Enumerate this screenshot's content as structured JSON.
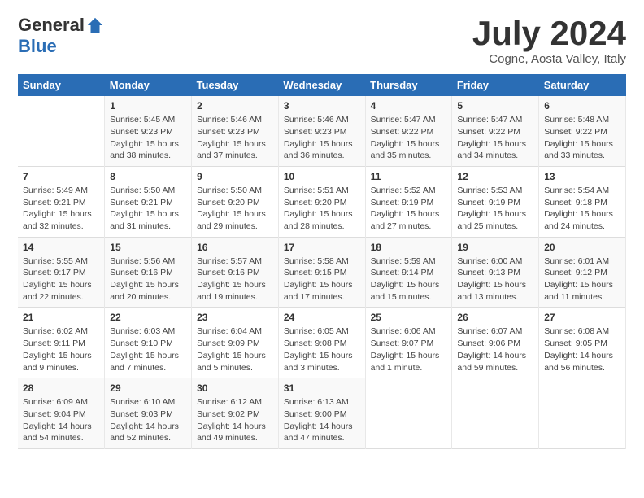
{
  "header": {
    "logo_general": "General",
    "logo_blue": "Blue",
    "month_year": "July 2024",
    "location": "Cogne, Aosta Valley, Italy"
  },
  "days_of_week": [
    "Sunday",
    "Monday",
    "Tuesday",
    "Wednesday",
    "Thursday",
    "Friday",
    "Saturday"
  ],
  "weeks": [
    [
      {
        "day": "",
        "content": ""
      },
      {
        "day": "1",
        "content": "Sunrise: 5:45 AM\nSunset: 9:23 PM\nDaylight: 15 hours\nand 38 minutes."
      },
      {
        "day": "2",
        "content": "Sunrise: 5:46 AM\nSunset: 9:23 PM\nDaylight: 15 hours\nand 37 minutes."
      },
      {
        "day": "3",
        "content": "Sunrise: 5:46 AM\nSunset: 9:23 PM\nDaylight: 15 hours\nand 36 minutes."
      },
      {
        "day": "4",
        "content": "Sunrise: 5:47 AM\nSunset: 9:22 PM\nDaylight: 15 hours\nand 35 minutes."
      },
      {
        "day": "5",
        "content": "Sunrise: 5:47 AM\nSunset: 9:22 PM\nDaylight: 15 hours\nand 34 minutes."
      },
      {
        "day": "6",
        "content": "Sunrise: 5:48 AM\nSunset: 9:22 PM\nDaylight: 15 hours\nand 33 minutes."
      }
    ],
    [
      {
        "day": "7",
        "content": "Sunrise: 5:49 AM\nSunset: 9:21 PM\nDaylight: 15 hours\nand 32 minutes."
      },
      {
        "day": "8",
        "content": "Sunrise: 5:50 AM\nSunset: 9:21 PM\nDaylight: 15 hours\nand 31 minutes."
      },
      {
        "day": "9",
        "content": "Sunrise: 5:50 AM\nSunset: 9:20 PM\nDaylight: 15 hours\nand 29 minutes."
      },
      {
        "day": "10",
        "content": "Sunrise: 5:51 AM\nSunset: 9:20 PM\nDaylight: 15 hours\nand 28 minutes."
      },
      {
        "day": "11",
        "content": "Sunrise: 5:52 AM\nSunset: 9:19 PM\nDaylight: 15 hours\nand 27 minutes."
      },
      {
        "day": "12",
        "content": "Sunrise: 5:53 AM\nSunset: 9:19 PM\nDaylight: 15 hours\nand 25 minutes."
      },
      {
        "day": "13",
        "content": "Sunrise: 5:54 AM\nSunset: 9:18 PM\nDaylight: 15 hours\nand 24 minutes."
      }
    ],
    [
      {
        "day": "14",
        "content": "Sunrise: 5:55 AM\nSunset: 9:17 PM\nDaylight: 15 hours\nand 22 minutes."
      },
      {
        "day": "15",
        "content": "Sunrise: 5:56 AM\nSunset: 9:16 PM\nDaylight: 15 hours\nand 20 minutes."
      },
      {
        "day": "16",
        "content": "Sunrise: 5:57 AM\nSunset: 9:16 PM\nDaylight: 15 hours\nand 19 minutes."
      },
      {
        "day": "17",
        "content": "Sunrise: 5:58 AM\nSunset: 9:15 PM\nDaylight: 15 hours\nand 17 minutes."
      },
      {
        "day": "18",
        "content": "Sunrise: 5:59 AM\nSunset: 9:14 PM\nDaylight: 15 hours\nand 15 minutes."
      },
      {
        "day": "19",
        "content": "Sunrise: 6:00 AM\nSunset: 9:13 PM\nDaylight: 15 hours\nand 13 minutes."
      },
      {
        "day": "20",
        "content": "Sunrise: 6:01 AM\nSunset: 9:12 PM\nDaylight: 15 hours\nand 11 minutes."
      }
    ],
    [
      {
        "day": "21",
        "content": "Sunrise: 6:02 AM\nSunset: 9:11 PM\nDaylight: 15 hours\nand 9 minutes."
      },
      {
        "day": "22",
        "content": "Sunrise: 6:03 AM\nSunset: 9:10 PM\nDaylight: 15 hours\nand 7 minutes."
      },
      {
        "day": "23",
        "content": "Sunrise: 6:04 AM\nSunset: 9:09 PM\nDaylight: 15 hours\nand 5 minutes."
      },
      {
        "day": "24",
        "content": "Sunrise: 6:05 AM\nSunset: 9:08 PM\nDaylight: 15 hours\nand 3 minutes."
      },
      {
        "day": "25",
        "content": "Sunrise: 6:06 AM\nSunset: 9:07 PM\nDaylight: 15 hours\nand 1 minute."
      },
      {
        "day": "26",
        "content": "Sunrise: 6:07 AM\nSunset: 9:06 PM\nDaylight: 14 hours\nand 59 minutes."
      },
      {
        "day": "27",
        "content": "Sunrise: 6:08 AM\nSunset: 9:05 PM\nDaylight: 14 hours\nand 56 minutes."
      }
    ],
    [
      {
        "day": "28",
        "content": "Sunrise: 6:09 AM\nSunset: 9:04 PM\nDaylight: 14 hours\nand 54 minutes."
      },
      {
        "day": "29",
        "content": "Sunrise: 6:10 AM\nSunset: 9:03 PM\nDaylight: 14 hours\nand 52 minutes."
      },
      {
        "day": "30",
        "content": "Sunrise: 6:12 AM\nSunset: 9:02 PM\nDaylight: 14 hours\nand 49 minutes."
      },
      {
        "day": "31",
        "content": "Sunrise: 6:13 AM\nSunset: 9:00 PM\nDaylight: 14 hours\nand 47 minutes."
      },
      {
        "day": "",
        "content": ""
      },
      {
        "day": "",
        "content": ""
      },
      {
        "day": "",
        "content": ""
      }
    ]
  ]
}
